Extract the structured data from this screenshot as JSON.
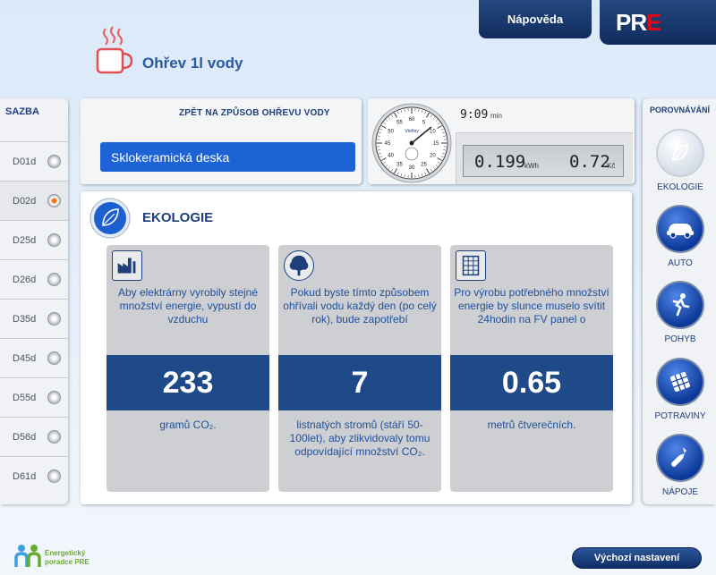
{
  "header": {
    "help_label": "Nápověda",
    "logo": {
      "p": "P",
      "r": "R",
      "e": "E"
    },
    "page_title": "Ohřev 1l vody"
  },
  "rates": {
    "title": "SAZBA",
    "items": [
      {
        "label": "D01d",
        "selected": false
      },
      {
        "label": "D02d",
        "selected": true
      },
      {
        "label": "D25d",
        "selected": false
      },
      {
        "label": "D26d",
        "selected": false
      },
      {
        "label": "D35d",
        "selected": false
      },
      {
        "label": "D45d",
        "selected": false
      },
      {
        "label": "D55d",
        "selected": false
      },
      {
        "label": "D56d",
        "selected": false
      },
      {
        "label": "D61d",
        "selected": false
      }
    ]
  },
  "method": {
    "back_label": "ZPĚT NA ZPŮSOB OHŘEVU VODY",
    "selected": "Sklokeramická deska"
  },
  "meter": {
    "stopwatch_label": "Vteřiny",
    "time_value": "9:09",
    "time_unit": "min",
    "energy_value": "0.199",
    "energy_unit": "kWh",
    "cost_value": "0.72",
    "cost_unit": "Kč"
  },
  "main": {
    "title": "EKOLOGIE",
    "cards": [
      {
        "icon": "factory-icon",
        "description": "Aby elektrárny vyrobily stejné množství energie, vypustí do vzduchu",
        "value": "233",
        "unit": "gramů CO₂."
      },
      {
        "icon": "tree-icon",
        "description": "Pokud byste tímto způsobem ohřívali vodu každý den (po celý rok), bude zapotřebí",
        "value": "7",
        "unit": "listnatých stromů (stáří 50-100let), aby zlikvidovaly tomu odpovídající množství CO₂."
      },
      {
        "icon": "solar-panel-icon",
        "description": "Pro výrobu potřebného množství energie by slunce muselo svítit 24hodin na FV panel o",
        "value": "0.65",
        "unit": "metrů čtverečních."
      }
    ]
  },
  "compare": {
    "title": "POROVNÁVÁNÍ",
    "items": [
      {
        "label": "EKOLOGIE",
        "icon": "leaf-icon"
      },
      {
        "label": "AUTO",
        "icon": "car-icon"
      },
      {
        "label": "POHYB",
        "icon": "runner-icon"
      },
      {
        "label": "POTRAVINY",
        "icon": "food-icon"
      },
      {
        "label": "NÁPOJE",
        "icon": "bottle-icon"
      }
    ]
  },
  "footer": {
    "brand_line1": "Energetický",
    "brand_line2": "poradce PRE",
    "reset_label": "Výchozí nastavení"
  }
}
